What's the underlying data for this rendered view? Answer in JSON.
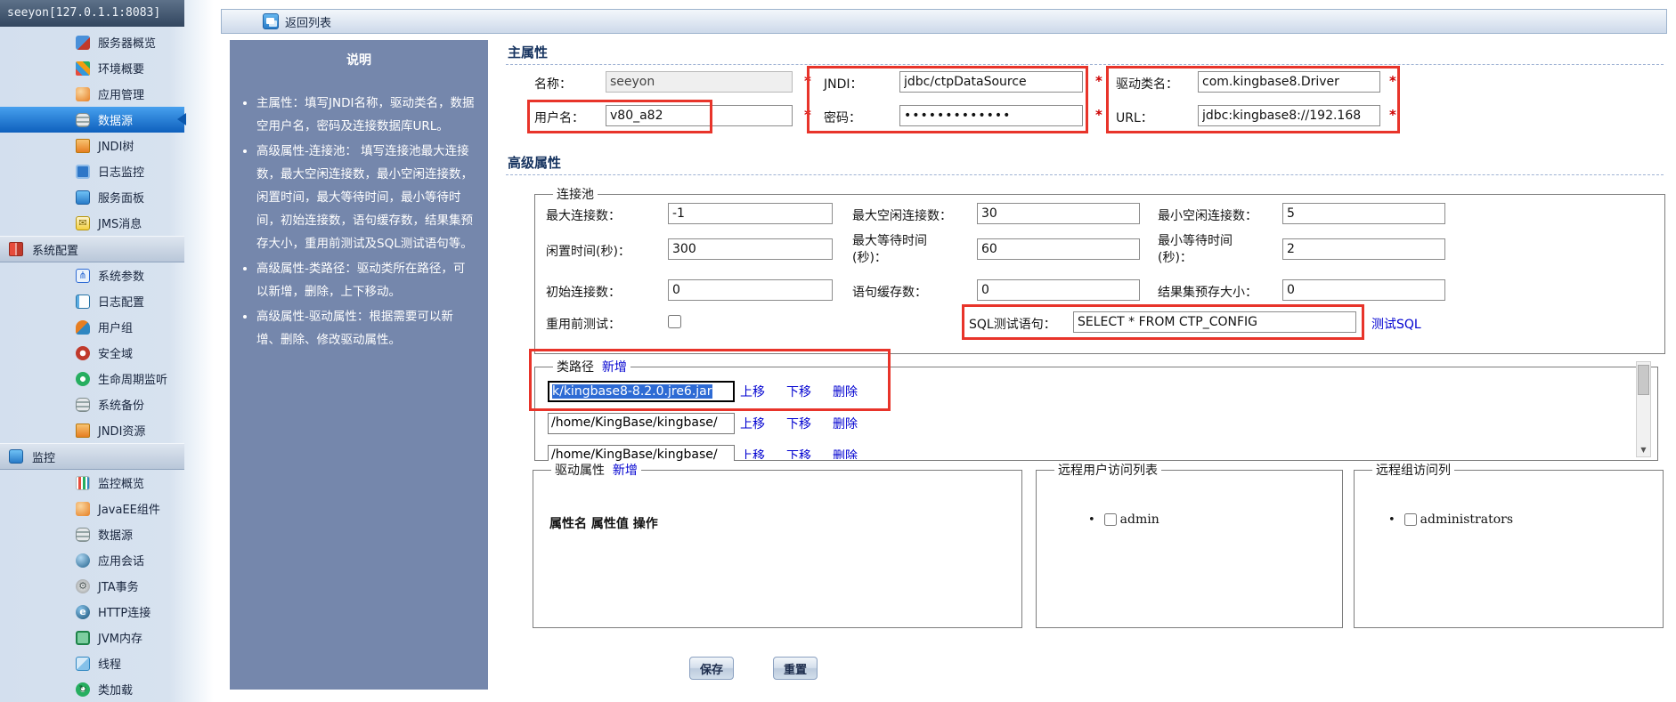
{
  "sidebar": {
    "title": "seeyon[127.0.1.1:8083]",
    "items": [
      {
        "label": "服务器概览",
        "icon": "server-icon"
      },
      {
        "label": "环境概要",
        "icon": "environment-icon"
      },
      {
        "label": "应用管理",
        "icon": "application-icon"
      },
      {
        "label": "数据源",
        "icon": "datasource-icon",
        "selected": true
      },
      {
        "label": "JNDI树",
        "icon": "jndi-tree-icon"
      },
      {
        "label": "日志监控",
        "icon": "log-monitor-icon"
      },
      {
        "label": "服务面板",
        "icon": "service-panel-icon"
      },
      {
        "label": "JMS消息",
        "icon": "jms-message-icon"
      },
      {
        "label": "系统配置",
        "icon": "system-config-icon",
        "section": true
      },
      {
        "label": "系统参数",
        "icon": "system-params-icon"
      },
      {
        "label": "日志配置",
        "icon": "log-config-icon"
      },
      {
        "label": "用户组",
        "icon": "user-group-icon"
      },
      {
        "label": "安全域",
        "icon": "security-domain-icon"
      },
      {
        "label": "生命周期监听",
        "icon": "lifecycle-icon"
      },
      {
        "label": "系统备份",
        "icon": "system-backup-icon"
      },
      {
        "label": "JNDI资源",
        "icon": "jndi-resource-icon"
      },
      {
        "label": "监控",
        "icon": "monitoring-icon",
        "section": true
      },
      {
        "label": "监控概览",
        "icon": "monitor-overview-icon"
      },
      {
        "label": "JavaEE组件",
        "icon": "javaee-icon"
      },
      {
        "label": "数据源",
        "icon": "datasource-icon"
      },
      {
        "label": "应用会话",
        "icon": "app-session-icon"
      },
      {
        "label": "JTA事务",
        "icon": "jta-icon"
      },
      {
        "label": "HTTP连接",
        "icon": "http-icon"
      },
      {
        "label": "JVM内存",
        "icon": "jvm-memory-icon"
      },
      {
        "label": "线程",
        "icon": "thread-icon"
      },
      {
        "label": "类加载",
        "icon": "classload-icon"
      }
    ]
  },
  "toolbar": {
    "back_label": "返回列表"
  },
  "help_panel": {
    "title": "说明",
    "bullets": [
      "主属性：填写JNDI名称，驱动类名，数据空用户名，密码及连接数据库URL。",
      "高级属性-连接池： 填写连接池最大连接数，最大空闲连接数，最小空闲连接数，闲置时间，最大等待时间，最小等待时间，初始连接数，语句缓存数，结果集预存大小，重用前测试及SQL测试语句等。",
      "高级属性-类路径：驱动类所在路径，可以新增，删除，上下移动。",
      "高级属性-驱动属性：根据需要可以新增、删除、修改驱动属性。"
    ]
  },
  "form": {
    "main_section_title": "主属性",
    "advanced_section_title": "高级属性",
    "required_marker": "*",
    "fields": {
      "name": {
        "label": "名称：",
        "value": "seeyon"
      },
      "username": {
        "label": "用户名：",
        "value": "v80_a82"
      },
      "jndi": {
        "label": "JNDI：",
        "value": "jdbc/ctpDataSource"
      },
      "password": {
        "label": "密码：",
        "value": "•••••••••••••"
      },
      "driver_class": {
        "label": "驱动类名：",
        "value": "com.kingbase8.Driver"
      },
      "url": {
        "label": "URL：",
        "value": "jdbc:kingbase8://192.168"
      }
    },
    "pool": {
      "legend": "连接池",
      "fields": {
        "max_connections": {
          "label": "最大连接数：",
          "value": "-1"
        },
        "max_idle": {
          "label": "最大空闲连接数：",
          "value": "30"
        },
        "min_idle": {
          "label": "最小空闲连接数：",
          "value": "5"
        },
        "idle_time": {
          "label": "闲置时间(秒)：",
          "value": "300"
        },
        "max_wait": {
          "label": "最大等待时间 (秒)：",
          "value": "60"
        },
        "min_wait": {
          "label": "最小等待时间 (秒)：",
          "value": "2"
        },
        "initial_connections": {
          "label": "初始连接数：",
          "value": "0"
        },
        "statement_cache": {
          "label": "语句缓存数：",
          "value": "0"
        },
        "resultset_prefetch": {
          "label": "结果集预存大小：",
          "value": "0"
        },
        "test_before_reuse": {
          "label": "重用前测试：",
          "checked": false
        },
        "sql_test": {
          "label": "SQL测试语句：",
          "value": "SELECT * FROM CTP_CONFIG"
        }
      },
      "test_sql_link": "测试SQL"
    },
    "classpath": {
      "legend": "类路径",
      "add_link": "新增",
      "move_up": "上移",
      "move_down": "下移",
      "delete": "删除",
      "rows": [
        {
          "value": "k/kingbase8-8.2.0.jre6.jar",
          "selected": true
        },
        {
          "value": "/home/KingBase/kingbase/",
          "selected": false
        },
        {
          "value": "/home/KingBase/kingbase/",
          "selected": false
        }
      ]
    },
    "driver_props": {
      "legend": "驱动属性",
      "add_link": "新增",
      "header": "属性名 属性值 操作"
    },
    "remote_users": {
      "legend": "远程用户访问列表",
      "items": [
        {
          "label": "admin",
          "checked": false
        }
      ]
    },
    "remote_groups": {
      "legend": "远程组访问列",
      "items": [
        {
          "label": "administrators",
          "checked": false
        }
      ]
    },
    "buttons": {
      "save": "保存",
      "reset": "重置"
    }
  },
  "icons": {
    "scroll_down_arrow": "▼"
  }
}
